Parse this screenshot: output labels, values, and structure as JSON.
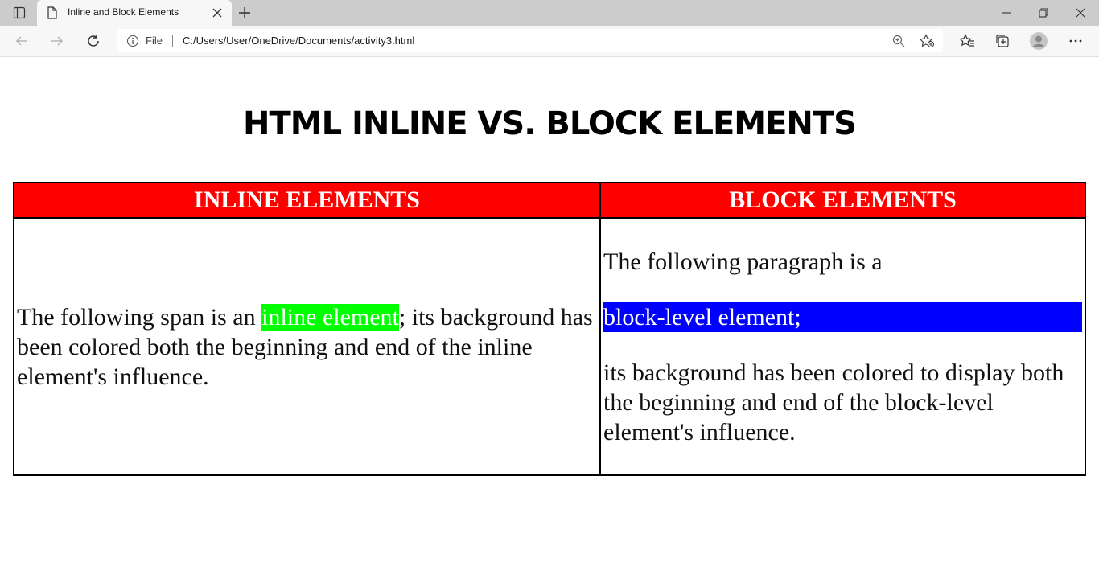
{
  "browser": {
    "tab_title": "Inline and Block Elements",
    "address_prefix": "File",
    "url": "C:/Users/User/OneDrive/Documents/activity3.html"
  },
  "page": {
    "heading": "HTML INLINE VS. BLOCK ELEMENTS",
    "table": {
      "headers": [
        "INLINE ELEMENTS",
        "BLOCK ELEMENTS"
      ],
      "inline_cell": {
        "before": "The following span is an ",
        "highlight": "inline element",
        "after": "; its background has been colored both the beginning and end of the inline element's influence."
      },
      "block_cell": {
        "before": "The following paragraph is a",
        "highlight": "block-level element;",
        "after": "its background has been colored to display both the beginning and end of the block-level element's influence."
      }
    },
    "colors": {
      "header_bg": "#ff0000",
      "inline_highlight": "#00ff00",
      "block_highlight": "#0000ff"
    }
  }
}
